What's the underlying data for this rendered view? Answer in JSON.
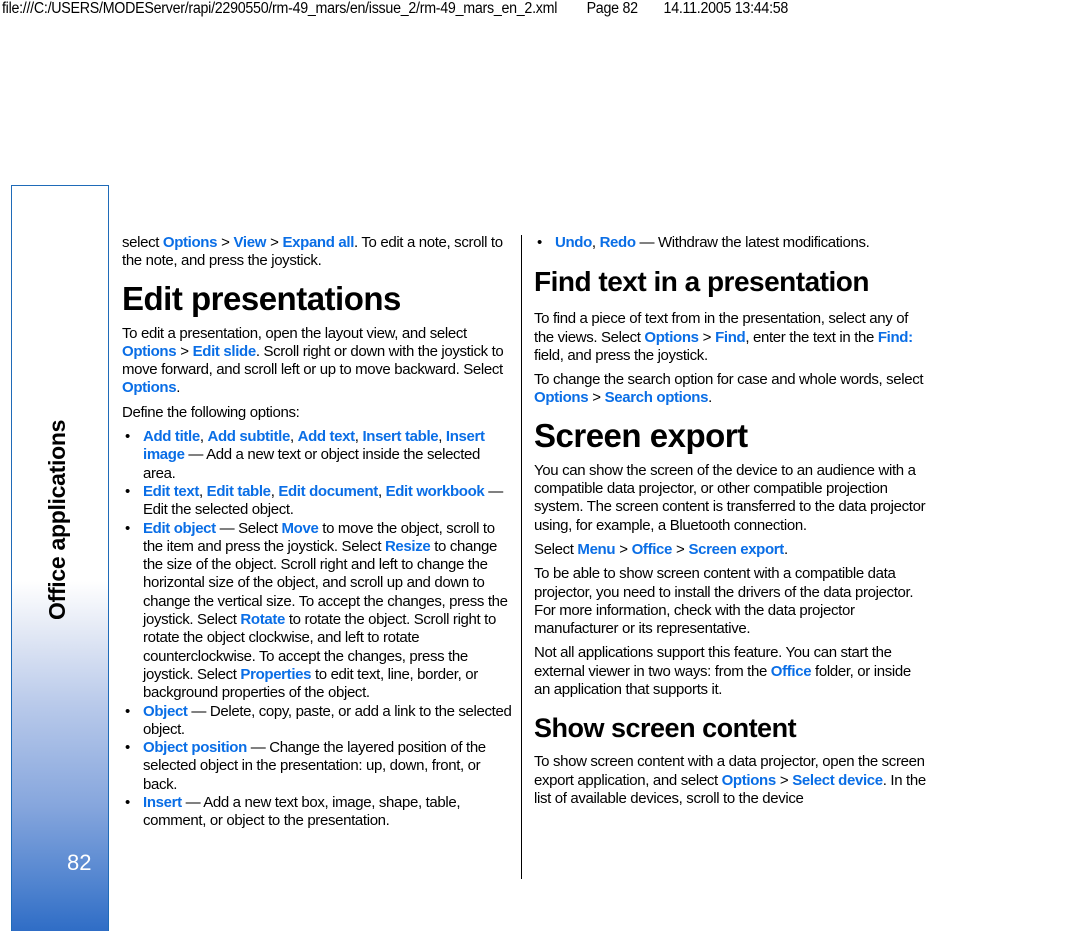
{
  "header": {
    "path": "file:///C:/USERS/MODEServer/rapi/2290550/rm-49_mars/en/issue_2/rm-49_mars_en_2.xml",
    "page": "Page 82",
    "timestamp": "14.11.2005 13:44:58"
  },
  "sidebar": {
    "section_title": "Office applications",
    "page_number": "82",
    "border_color": "#1f6bb8",
    "gradient_bottom": "#2f6dc6"
  },
  "colors": {
    "link": "#0a6ee6",
    "text": "#000000"
  },
  "col1": {
    "intro": {
      "t1": "select ",
      "l1": "Options",
      "g1": ">",
      "l2": "View",
      "g2": ">",
      "l3": "Expand all",
      "t2": ". To edit a note, scroll to the note, and press the joystick."
    },
    "heading": "Edit presentations",
    "p1": {
      "t1": "To edit a presentation, open the layout view, and select ",
      "l1": "Options",
      "g1": ">",
      "l2": "Edit slide",
      "t2": ". Scroll right or down with the joystick to move forward, and scroll left or up to move backward. Select ",
      "l3": "Options",
      "t3": "."
    },
    "p2": "Define the following options:",
    "bullets": [
      {
        "l1": "Add title",
        "s1": ", ",
        "l2": "Add subtitle",
        "s2": ", ",
        "l3": "Add text",
        "s3": ", ",
        "l4": "Insert table",
        "s4": ", ",
        "l5": "Insert image",
        "t": " — Add a new text or object inside the selected area."
      },
      {
        "l1": "Edit text",
        "s1": ", ",
        "l2": "Edit table",
        "s2": ", ",
        "l3": "Edit document",
        "s3": ", ",
        "l4": "Edit workbook",
        "t": " — Edit the selected object."
      },
      {
        "l1": "Edit object",
        "t1": " — Select ",
        "l2": "Move",
        "t2": " to move the object, scroll to the item and press the joystick. Select ",
        "l3": "Resize",
        "t3": " to change the size of the object. Scroll right and left to change the horizontal size of the object, and scroll up and down to change the vertical size. To accept the changes, press the joystick. Select ",
        "l4": "Rotate",
        "t4": " to rotate the object. Scroll right to rotate the object clockwise, and left to rotate counterclockwise. To accept the changes, press the joystick. Select ",
        "l5": "Properties",
        "t5": " to edit text, line, border, or background properties of the object."
      },
      {
        "l1": "Object",
        "t": " — Delete, copy, paste, or add a link to the selected object."
      },
      {
        "l1": "Object position",
        "t": " — Change the layered position of the selected object in the presentation: up, down, front, or back."
      },
      {
        "l1": "Insert",
        "t": " — Add a new text box, image, shape, table, comment, or object to the presentation."
      }
    ]
  },
  "col2": {
    "bullet": {
      "l1": "Undo",
      "s1": ", ",
      "l2": "Redo",
      "t": " — Withdraw the latest modifications."
    },
    "find_heading": "Find text in a presentation",
    "find_p1": {
      "t1": "To find a piece of text from in the presentation, select any of the views. Select ",
      "l1": "Options",
      "g1": ">",
      "l2": "Find",
      "t2": ", enter the text in the ",
      "l3": "Find:",
      "t3": " field, and press the joystick."
    },
    "find_p2": {
      "t1": "To change the search option for case and whole words, select ",
      "l1": "Options",
      "g1": ">",
      "l2": "Search options",
      "t2": "."
    },
    "export_heading": "Screen export",
    "export_p1": "You can show the screen of the device to an audience with a compatible data projector, or other compatible projection system. The screen content is transferred to the data projector using, for example, a Bluetooth connection.",
    "export_p2": {
      "t1": "Select ",
      "l1": "Menu",
      "g1": ">",
      "l2": "Office",
      "g2": ">",
      "l3": "Screen export",
      "t2": "."
    },
    "export_p3": "To be able to show screen content with a compatible data projector, you need to install the drivers of the data projector. For more information, check with the data projector manufacturer or its representative.",
    "export_p4": {
      "t1": "Not all applications support this feature. You can start the external viewer in two ways: from the ",
      "l1": "Office",
      "t2": " folder, or inside an application that supports it."
    },
    "show_heading": "Show screen content",
    "show_p1": {
      "t1": "To show screen content with a data projector, open the screen export application, and select ",
      "l1": "Options",
      "g1": ">",
      "l2": "Select device",
      "t2": ". In the list of available devices, scroll to the device"
    }
  }
}
